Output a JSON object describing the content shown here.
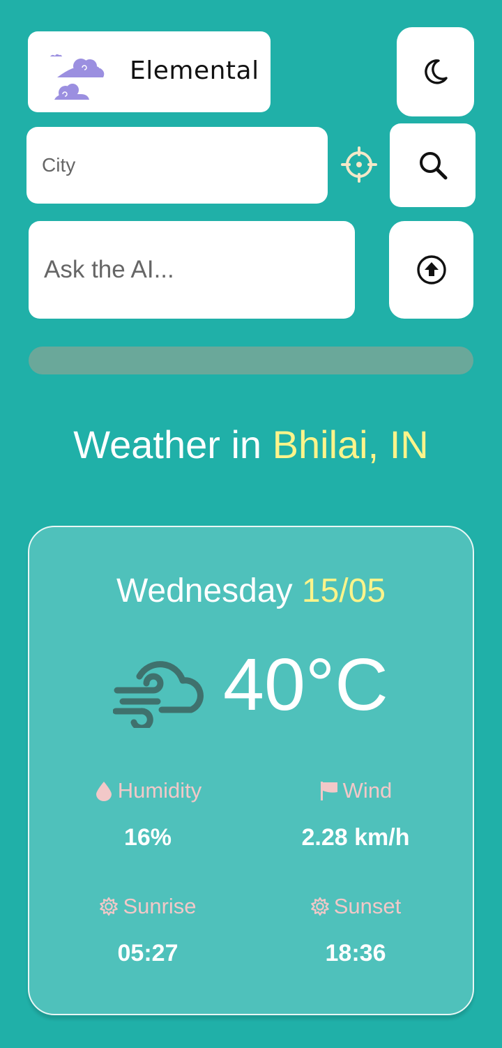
{
  "app": {
    "name": "Elemental"
  },
  "search": {
    "city_placeholder": "City",
    "ai_placeholder": "Ask the AI..."
  },
  "progress": {
    "value": 0
  },
  "headline": {
    "prefix": "Weather in",
    "location": "Bhilai, IN"
  },
  "forecast": {
    "day": "Wednesday",
    "date": "15/05",
    "temperature": "40°C",
    "condition_icon": "wind-cloud-icon",
    "stats": {
      "humidity": {
        "label": "Humidity",
        "value": "16%",
        "icon": "droplet-icon"
      },
      "wind": {
        "label": "Wind",
        "value": "2.28 km/h",
        "icon": "flag-icon"
      },
      "sunrise": {
        "label": "Sunrise",
        "value": "05:27",
        "icon": "gear-icon"
      },
      "sunset": {
        "label": "Sunset",
        "value": "18:36",
        "icon": "gear-icon"
      }
    }
  },
  "colors": {
    "background": "#20b0a8",
    "card": "#4fc1bb",
    "accent_yellow": "#fef48a",
    "label_pink": "#f2c8c8",
    "logo_purple": "#9b8fe0"
  }
}
